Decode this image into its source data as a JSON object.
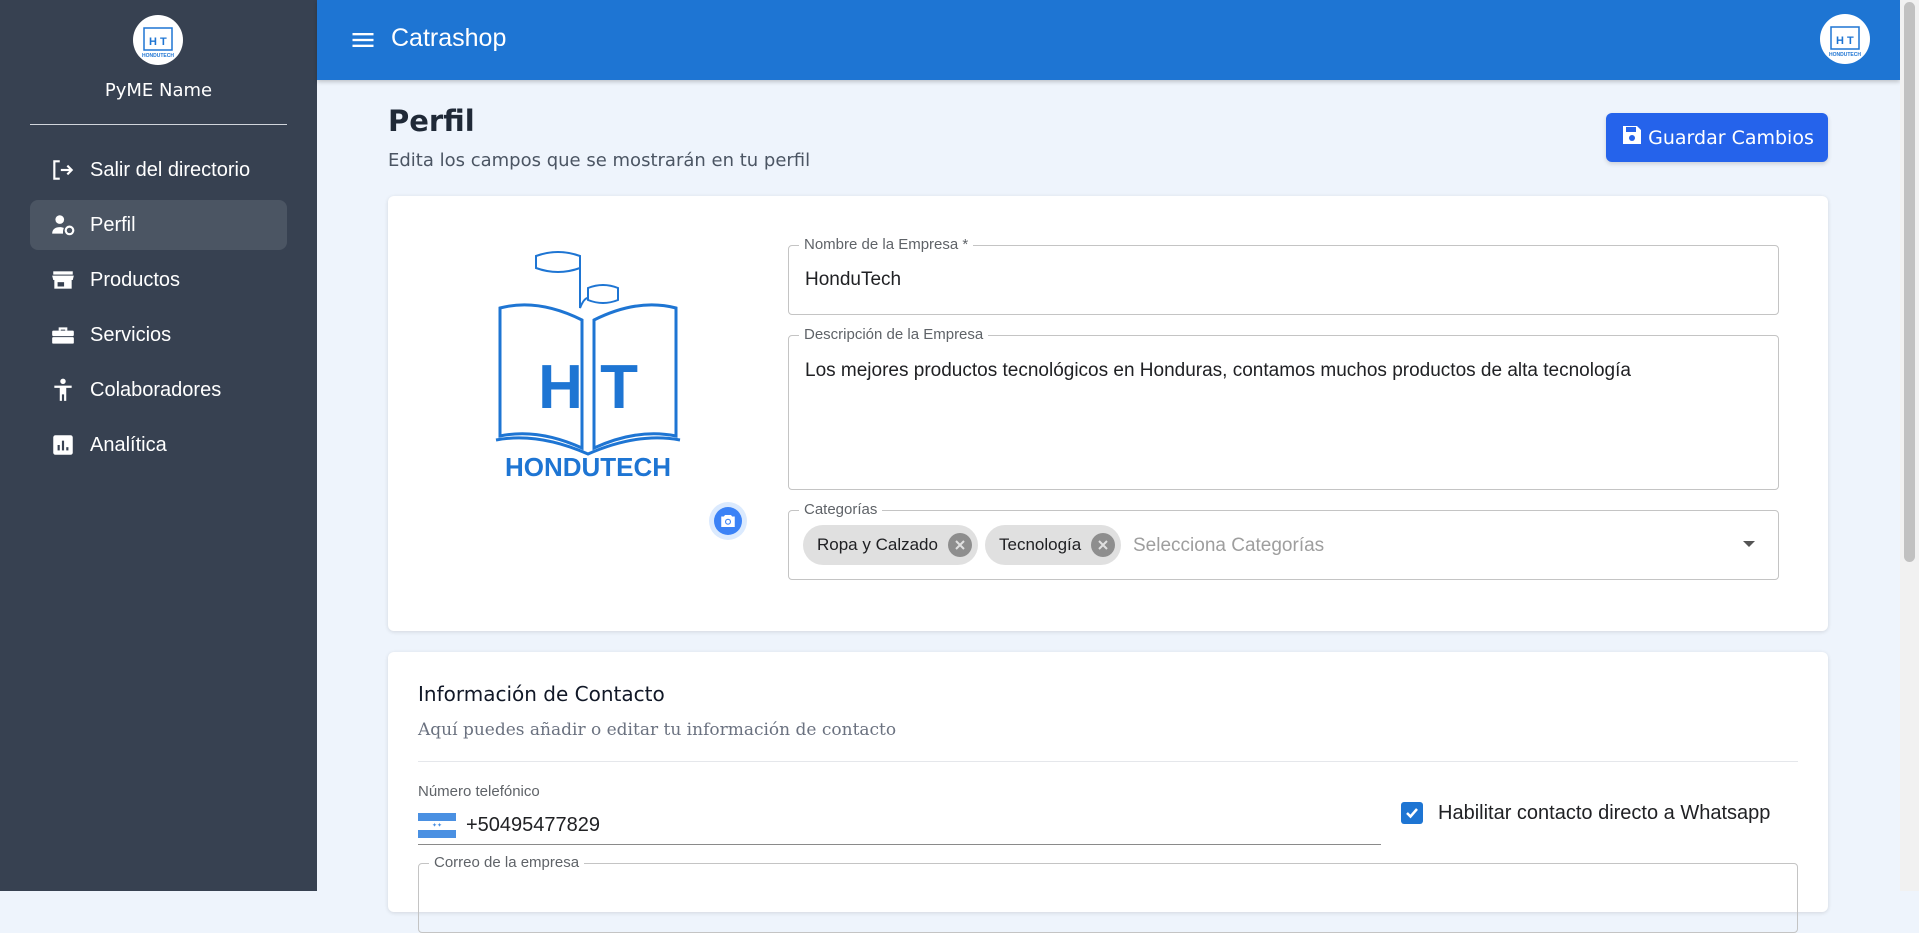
{
  "sidebar": {
    "logo_letters": "H T",
    "logo_text": "HONDUTECH",
    "pyme_name": "PyME Name",
    "items": [
      {
        "label": "Salir del directorio",
        "icon": "logout-icon",
        "active": false
      },
      {
        "label": "Perfil",
        "icon": "user-gear-icon",
        "active": true
      },
      {
        "label": "Productos",
        "icon": "store-icon",
        "active": false
      },
      {
        "label": "Servicios",
        "icon": "toolbox-icon",
        "active": false
      },
      {
        "label": "Colaboradores",
        "icon": "person-icon",
        "active": false
      },
      {
        "label": "Analítica",
        "icon": "analytics-icon",
        "active": false
      }
    ]
  },
  "topbar": {
    "title": "Catrashop",
    "menu_icon": "hamburger-menu-icon"
  },
  "page": {
    "title": "Perfil",
    "subtitle": "Edita los campos que se mostrarán en tu perfil",
    "save_label": "Guardar Cambios"
  },
  "profile": {
    "name_label": "Nombre de la Empresa *",
    "name_value": "HonduTech",
    "desc_label": "Descripción de la Empresa",
    "desc_value": "Los mejores productos tecnológicos en Honduras, contamos muchos productos de alta tecnología",
    "cat_label": "Categorías",
    "categories": [
      "Ropa y Calzado",
      "Tecnología"
    ],
    "cat_placeholder": "Selecciona Categorías"
  },
  "contact": {
    "title": "Información de Contacto",
    "subtitle": "Aquí puedes añadir o editar tu información de contacto",
    "phone_label": "Número telefónico",
    "phone_value": "+50495477829",
    "whatsapp_label": "Habilitar contacto directo a Whatsapp",
    "whatsapp_checked": true,
    "email_label": "Correo de la empresa"
  },
  "colors": {
    "topbar": "#1e75d3",
    "sidebar": "#374151",
    "primary_button": "#2563eb",
    "flag_blue": "#4a90e2"
  }
}
